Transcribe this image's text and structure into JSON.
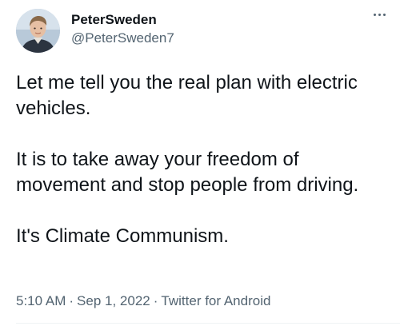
{
  "author": {
    "display_name": "PeterSweden",
    "handle": "@PeterSweden7"
  },
  "avatar_icon": "avatar-photo",
  "more_icon": "more-horizontal-icon",
  "tweet": {
    "paragraphs": [
      "Let me tell you the real plan with electric vehicles.",
      "It is to take away your freedom of movement and stop people from driving.",
      "It's Climate Communism."
    ],
    "time": "5:10 AM",
    "date": "Sep 1, 2022",
    "separator": "·",
    "source": "Twitter for Android"
  },
  "colors": {
    "text_primary": "#0f1419",
    "text_secondary": "#536471",
    "divider": "#eff3f4"
  }
}
